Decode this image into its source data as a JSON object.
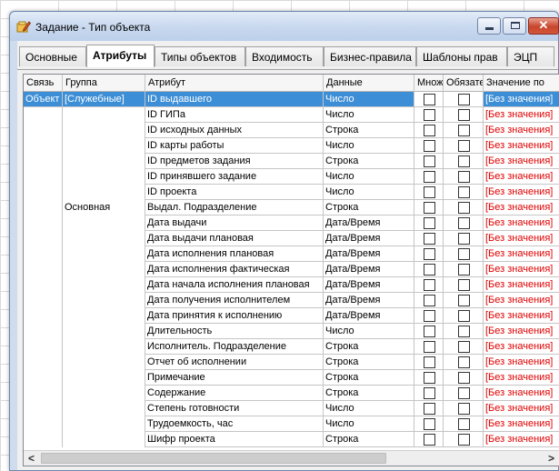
{
  "window": {
    "title": "Задание - Тип объекта",
    "icon": "edit-object-icon"
  },
  "tabs": [
    {
      "label": "Основные",
      "active": false
    },
    {
      "label": "Атрибуты",
      "active": true
    },
    {
      "label": "Типы объектов",
      "active": false
    },
    {
      "label": "Входимость",
      "active": false
    },
    {
      "label": "Бизнес-правила",
      "active": false
    },
    {
      "label": "Шаблоны прав",
      "active": false
    },
    {
      "label": "ЭЦП",
      "active": false
    }
  ],
  "table": {
    "columns": [
      "Связь",
      "Группа",
      "Атрибут",
      "Данные",
      "Множ",
      "Обязате",
      "Значение по"
    ],
    "rows": [
      {
        "link": "Объект",
        "group": "[Служебные]",
        "attr": "ID выдавшего",
        "data": "Число",
        "value": "[Без значения]",
        "selected": true
      },
      {
        "link": "",
        "group": "",
        "attr": "ID ГИПа",
        "data": "Число",
        "value": "[Без значения]"
      },
      {
        "link": "",
        "group": "",
        "attr": "ID исходных данных",
        "data": "Строка",
        "value": "[Без значения]"
      },
      {
        "link": "",
        "group": "",
        "attr": "ID карты работы",
        "data": "Число",
        "value": "[Без значения]"
      },
      {
        "link": "",
        "group": "",
        "attr": "ID предметов задания",
        "data": "Строка",
        "value": "[Без значения]"
      },
      {
        "link": "",
        "group": "",
        "attr": "ID принявшего задание",
        "data": "Число",
        "value": "[Без значения]"
      },
      {
        "link": "",
        "group": "",
        "attr": "ID проекта",
        "data": "Число",
        "value": "[Без значения]"
      },
      {
        "link": "",
        "group": "Основная",
        "attr": "Выдал. Подразделение",
        "data": "Строка",
        "value": "[Без значения]"
      },
      {
        "link": "",
        "group": "",
        "attr": "Дата выдачи",
        "data": "Дата/Время",
        "value": "[Без значения]"
      },
      {
        "link": "",
        "group": "",
        "attr": "Дата выдачи плановая",
        "data": "Дата/Время",
        "value": "[Без значения]"
      },
      {
        "link": "",
        "group": "",
        "attr": "Дата исполнения плановая",
        "data": "Дата/Время",
        "value": "[Без значения]"
      },
      {
        "link": "",
        "group": "",
        "attr": "Дата исполнения фактическая",
        "data": "Дата/Время",
        "value": "[Без значения]"
      },
      {
        "link": "",
        "group": "",
        "attr": "Дата начала исполнения плановая",
        "data": "Дата/Время",
        "value": "[Без значения]"
      },
      {
        "link": "",
        "group": "",
        "attr": "Дата получения исполнителем",
        "data": "Дата/Время",
        "value": "[Без значения]"
      },
      {
        "link": "",
        "group": "",
        "attr": "Дата принятия к исполнению",
        "data": "Дата/Время",
        "value": "[Без значения]"
      },
      {
        "link": "",
        "group": "",
        "attr": "Длительность",
        "data": "Число",
        "value": "[Без значения]"
      },
      {
        "link": "",
        "group": "",
        "attr": "Исполнитель. Подразделение",
        "data": "Строка",
        "value": "[Без значения]"
      },
      {
        "link": "",
        "group": "",
        "attr": "Отчет об исполнении",
        "data": "Строка",
        "value": "[Без значения]"
      },
      {
        "link": "",
        "group": "",
        "attr": "Примечание",
        "data": "Строка",
        "value": "[Без значения]"
      },
      {
        "link": "",
        "group": "",
        "attr": "Содержание",
        "data": "Строка",
        "value": "[Без значения]"
      },
      {
        "link": "",
        "group": "",
        "attr": "Степень готовности",
        "data": "Число",
        "value": "[Без значения]"
      },
      {
        "link": "",
        "group": "",
        "attr": "Трудоемкость, час",
        "data": "Число",
        "value": "[Без значения]"
      },
      {
        "link": "",
        "group": "",
        "attr": "Шифр проекта",
        "data": "Строка",
        "value": "[Без значения]"
      }
    ]
  },
  "colors": {
    "selection": "#3c8ed6",
    "empty_value": "#e00000"
  }
}
